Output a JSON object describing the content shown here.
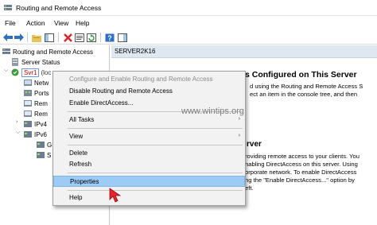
{
  "window": {
    "title": "Routing and Remote Access"
  },
  "menubar": [
    "File",
    "Action",
    "View",
    "Help"
  ],
  "toolbar": {
    "icons": [
      "back-arrow-icon",
      "forward-arrow-icon",
      "up-folder-icon",
      "show-hide-tree-icon",
      "delete-icon",
      "properties-icon",
      "refresh-icon",
      "export-icon",
      "help-icon",
      "console-pane-icon"
    ]
  },
  "tree": {
    "root": "Routing and Remote Access",
    "server_status": "Server Status",
    "server": "Svr1",
    "server_suffix": "(loc",
    "children": [
      "Netw",
      "Ports",
      "Rem",
      "Rem",
      "IPv4",
      "IPv6"
    ],
    "ipv6_children": [
      "G",
      "S"
    ]
  },
  "content": {
    "header": "SERVER2K16",
    "heading": "s Configured on This Server",
    "para1": [
      "d using the Routing and Remote Access S",
      "ect an item in the console tree, and then"
    ],
    "subheading": "rver",
    "para2": [
      "roviding remote access to your clients. You",
      "nabling DirectAccess on this server. Using",
      "orporate network. To enable DirectAccess",
      "ng the \"Enable DirectAccess...\" option by",
      "eft."
    ]
  },
  "context_menu": {
    "items": [
      {
        "label": "Configure and Enable Routing and Remote Access",
        "disabled": true
      },
      {
        "label": "Disable Routing and Remote Access",
        "disabled": false
      },
      {
        "label": "Enable DirectAccess...",
        "disabled": false
      },
      {
        "label": "All Tasks",
        "disabled": false,
        "submenu": true
      },
      {
        "label": "View",
        "disabled": false,
        "submenu": true
      },
      {
        "label": "Delete",
        "disabled": false
      },
      {
        "label": "Refresh",
        "disabled": false
      },
      {
        "label": "Properties",
        "disabled": false,
        "highlighted": true
      },
      {
        "label": "Help",
        "disabled": false
      }
    ],
    "submenu_glyph": "›"
  },
  "watermark": "www.wintips.org",
  "colors": {
    "highlight": "#9ccbf5",
    "server_label": "#c00000",
    "cursor": "#e8232a",
    "header_band": "#dfe7f1"
  }
}
